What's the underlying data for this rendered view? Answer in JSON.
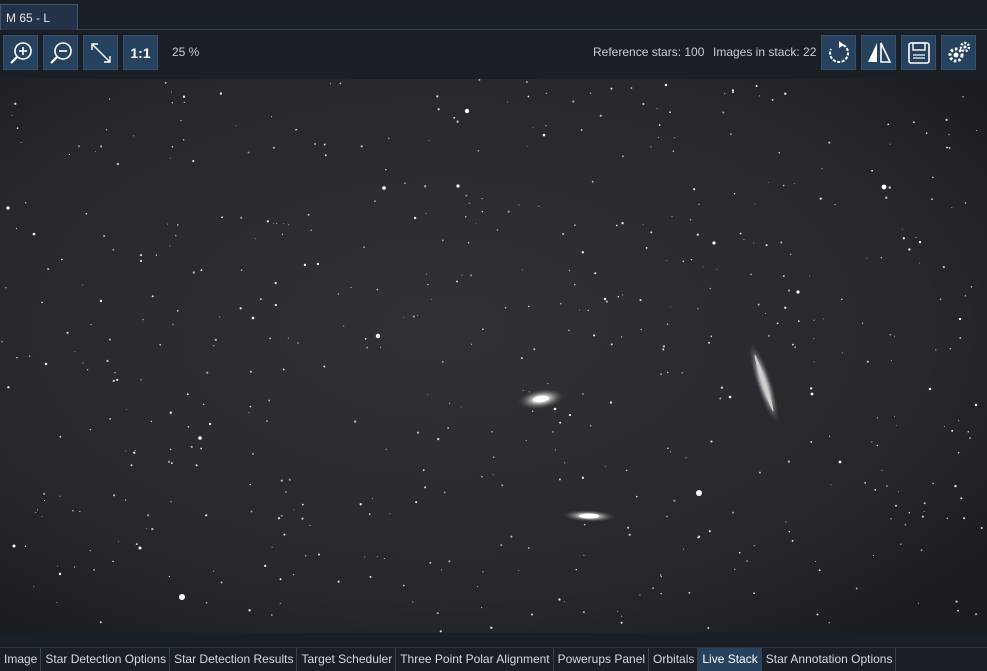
{
  "document_tab": {
    "title": "M 65 - L"
  },
  "toolbar": {
    "zoom_in_icon": "zoom-in-icon",
    "zoom_out_icon": "zoom-out-icon",
    "fit_icon": "fit-to-window-icon",
    "one_to_one_label": "1:1",
    "zoom_level": "25 %",
    "reference_stars": "Reference stars: 100",
    "images_in_stack": "Images in stack: 22",
    "rotate_icon": "rotate-icon",
    "flip_icon": "flip-icon",
    "save_icon": "save-icon",
    "settings_icon": "settings-icon",
    "accent_color": "#27425e"
  },
  "bottom_tabs": [
    {
      "label": "Image"
    },
    {
      "label": "Star Detection Options"
    },
    {
      "label": "Star Detection Results"
    },
    {
      "label": "Target Scheduler"
    },
    {
      "label": "Three Point Polar Alignment"
    },
    {
      "label": "Powerups Panel"
    },
    {
      "label": "Orbitals"
    },
    {
      "label": "Live Stack",
      "active": true
    },
    {
      "label": "Star Annotation Options"
    }
  ]
}
